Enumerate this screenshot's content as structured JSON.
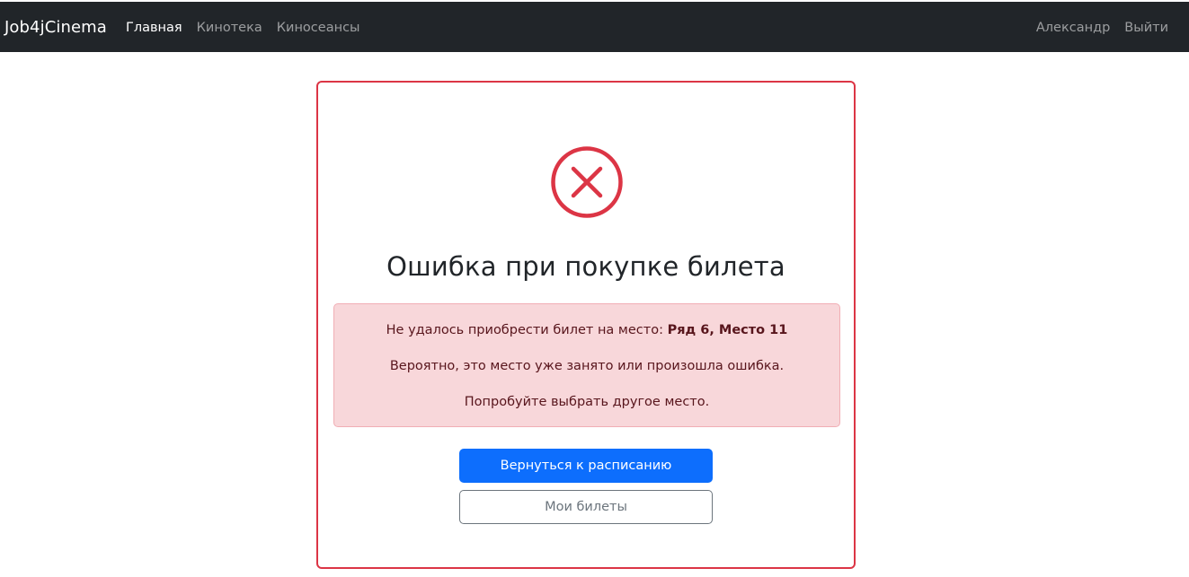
{
  "navbar": {
    "brand": "Job4jCinema",
    "links": [
      {
        "label": "Главная"
      },
      {
        "label": "Кинотека"
      },
      {
        "label": "Киносеансы"
      }
    ],
    "user_name": "Александр",
    "logout_label": "Выйти"
  },
  "error_card": {
    "icon": "x-circle-icon",
    "title": "Ошибка при покупке билета",
    "alert": {
      "line1_prefix": "Не удалось приобрести билет на место: ",
      "seat": "Ряд 6, Место 11",
      "line2": "Вероятно, это место уже занято или произошла ошибка.",
      "line3": "Попробуйте выбрать другое место."
    },
    "primary_button": "Вернуться к расписанию",
    "secondary_button": "Мои билеты"
  },
  "colors": {
    "navbar_bg": "#212529",
    "danger": "#dc3545",
    "alert_bg": "#f8d7da",
    "primary": "#0d6efd",
    "secondary": "#6c757d"
  }
}
